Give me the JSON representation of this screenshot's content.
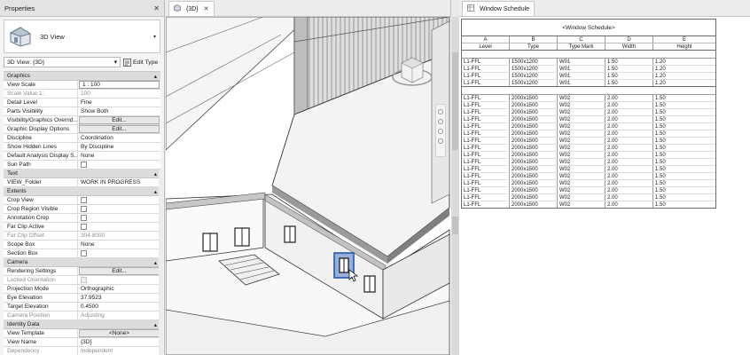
{
  "properties": {
    "title": "Properties",
    "close": "✕",
    "type_selector": {
      "name": "3D View",
      "arrow": "▾"
    },
    "instance": {
      "selected": "3D View: {3D}",
      "edit_type": "Edit Type"
    },
    "sections": [
      {
        "name": "Graphics",
        "rows": [
          {
            "name": "View Scale",
            "value": "1 : 100",
            "kind": "box"
          },
          {
            "name": "Scale Value    1:",
            "value": "100",
            "kind": "dis"
          },
          {
            "name": "Detail Level",
            "value": "Fine",
            "kind": "text"
          },
          {
            "name": "Parts Visibility",
            "value": "Show Both",
            "kind": "text"
          },
          {
            "name": "Visibility/Graphics Overrid...",
            "value": "Edit...",
            "kind": "button"
          },
          {
            "name": "Graphic Display Options",
            "value": "Edit...",
            "kind": "button"
          },
          {
            "name": "Discipline",
            "value": "Coordination",
            "kind": "text"
          },
          {
            "name": "Show Hidden Lines",
            "value": "By Discipline",
            "kind": "text"
          },
          {
            "name": "Default Analysis Display S...",
            "value": "None",
            "kind": "text"
          },
          {
            "name": "Sun Path",
            "value": "",
            "kind": "check"
          }
        ]
      },
      {
        "name": "Text",
        "rows": [
          {
            "name": "VIEW_Folder",
            "value": "WORK IN PROGRESS",
            "kind": "text"
          }
        ]
      },
      {
        "name": "Extents",
        "rows": [
          {
            "name": "Crop View",
            "value": "",
            "kind": "check"
          },
          {
            "name": "Crop Region Visible",
            "value": "",
            "kind": "check"
          },
          {
            "name": "Annotation Crop",
            "value": "",
            "kind": "check"
          },
          {
            "name": "Far Clip Active",
            "value": "",
            "kind": "check"
          },
          {
            "name": "Far Clip Offset",
            "value": "304.8000",
            "kind": "dis"
          },
          {
            "name": "Scope Box",
            "value": "None",
            "kind": "text"
          },
          {
            "name": "Section Box",
            "value": "",
            "kind": "check"
          }
        ]
      },
      {
        "name": "Camera",
        "rows": [
          {
            "name": "Rendering Settings",
            "value": "Edit...",
            "kind": "button"
          },
          {
            "name": "Locked Orientation",
            "value": "",
            "kind": "dischk"
          },
          {
            "name": "Projection Mode",
            "value": "Orthographic",
            "kind": "text"
          },
          {
            "name": "Eye Elevation",
            "value": "37.9523",
            "kind": "text"
          },
          {
            "name": "Target Elevation",
            "value": "0.4500",
            "kind": "text"
          },
          {
            "name": "Camera Position",
            "value": "Adjusting",
            "kind": "dis"
          }
        ]
      },
      {
        "name": "Identity Data",
        "rows": [
          {
            "name": "View Template",
            "value": "<None>",
            "kind": "button"
          },
          {
            "name": "View Name",
            "value": "{3D}",
            "kind": "text"
          },
          {
            "name": "Dependency",
            "value": "Independent",
            "kind": "dis"
          }
        ]
      }
    ]
  },
  "view3d": {
    "tab_label": "{3D}",
    "tab_close": "✕"
  },
  "schedule": {
    "tab_label": "Window Schedule",
    "title": "<Window Schedule>",
    "letters": [
      "A",
      "B",
      "C",
      "D",
      "E"
    ],
    "columns": [
      "Level",
      "Type",
      "Type Mark",
      "Width",
      "Height"
    ],
    "groups": [
      {
        "rows": [
          [
            "L1-FFL",
            "1500x1200",
            "W01",
            "1.50",
            "1.20"
          ],
          [
            "L1-FFL",
            "1500x1200",
            "W01",
            "1.50",
            "1.20"
          ],
          [
            "L1-FFL",
            "1500x1200",
            "W01",
            "1.50",
            "1.20"
          ],
          [
            "L1-FFL",
            "1500x1200",
            "W01",
            "1.50",
            "1.20"
          ]
        ]
      },
      {
        "rows": [
          [
            "L1-FFL",
            "2000x1500",
            "W02",
            "2.00",
            "1.50"
          ],
          [
            "L1-FFL",
            "2000x1500",
            "W02",
            "2.00",
            "1.50"
          ],
          [
            "L1-FFL",
            "2000x1500",
            "W02",
            "2.00",
            "1.50"
          ],
          [
            "L1-FFL",
            "2000x1500",
            "W02",
            "2.00",
            "1.50"
          ],
          [
            "L1-FFL",
            "2000x1500",
            "W02",
            "2.00",
            "1.50"
          ],
          [
            "L1-FFL",
            "2000x1500",
            "W02",
            "2.00",
            "1.50"
          ],
          [
            "L1-FFL",
            "2000x1500",
            "W02",
            "2.00",
            "1.50"
          ],
          [
            "L1-FFL",
            "2000x1500",
            "W02",
            "2.00",
            "1.50"
          ],
          [
            "L1-FFL",
            "2000x1500",
            "W02",
            "2.00",
            "1.50"
          ],
          [
            "L1-FFL",
            "2000x1500",
            "W02",
            "2.00",
            "1.50"
          ],
          [
            "L1-FFL",
            "2000x1500",
            "W02",
            "2.00",
            "1.50"
          ],
          [
            "L1-FFL",
            "2000x1500",
            "W02",
            "2.00",
            "1.50"
          ],
          [
            "L1-FFL",
            "2000x1500",
            "W02",
            "2.00",
            "1.50"
          ],
          [
            "L1-FFL",
            "2000x1500",
            "W02",
            "2.00",
            "1.50"
          ],
          [
            "L1-FFL",
            "2000x1500",
            "W02",
            "2.00",
            "1.50"
          ],
          [
            "L1-FFL",
            "2000x1500",
            "W02",
            "2.00",
            "1.50"
          ]
        ]
      }
    ]
  }
}
